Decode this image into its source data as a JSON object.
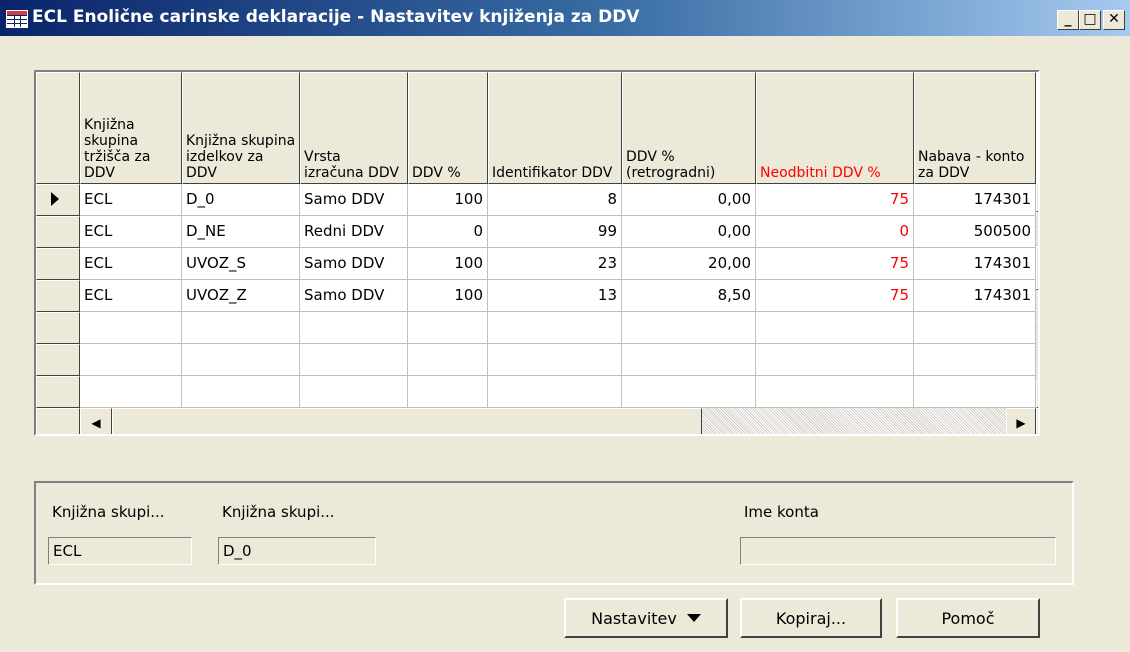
{
  "window": {
    "title": "ECL Enolične carinske deklaracije - Nastavitev knjiženja za DDV",
    "controls": {
      "minimize": "_",
      "maximize": "□",
      "close": "✕"
    }
  },
  "grid": {
    "columns": [
      {
        "label": "Knjižna skupina tržišča za DDV",
        "color": "#000000"
      },
      {
        "label": "Knjižna skupina izdelkov za DDV",
        "color": "#000000"
      },
      {
        "label": "Vrsta izračuna DDV",
        "color": "#000000"
      },
      {
        "label": "DDV %",
        "color": "#000000"
      },
      {
        "label": "Identifikator DDV",
        "color": "#000000"
      },
      {
        "label": "DDV % (retrogradni)",
        "color": "#000000"
      },
      {
        "label": "Neodbitni DDV %",
        "color": "#ff0000"
      },
      {
        "label": "Nabava - konto za DDV",
        "color": "#000000"
      }
    ],
    "rows": [
      [
        "ECL",
        "D_0",
        "Samo DDV",
        "100",
        "8",
        "0,00",
        "75",
        "174301"
      ],
      [
        "ECL",
        "D_NE",
        "Redni DDV",
        "0",
        "99",
        "0,00",
        "0",
        "500500"
      ],
      [
        "ECL",
        "UVOZ_S",
        "Samo DDV",
        "100",
        "23",
        "20,00",
        "75",
        "174301"
      ],
      [
        "ECL",
        "UVOZ_Z",
        "Samo DDV",
        "100",
        "13",
        "8,50",
        "75",
        "174301"
      ]
    ],
    "empty_row_count": 3,
    "selected_row": 0
  },
  "info": {
    "label_market_group": "Knjižna skupi...",
    "value_market_group": "ECL",
    "label_product_group": "Knjižna skupi...",
    "value_product_group": "D_0",
    "label_account_name": "Ime konta",
    "value_account_name": ""
  },
  "buttons": {
    "setup": "Nastavitev",
    "copy": "Kopiraj...",
    "help": "Pomoč"
  },
  "colors": {
    "title_bar_start": "#0a246a",
    "title_bar_end": "#a6caf0",
    "window_bg": "#ece9d8",
    "highlight_red": "#ff0000"
  }
}
